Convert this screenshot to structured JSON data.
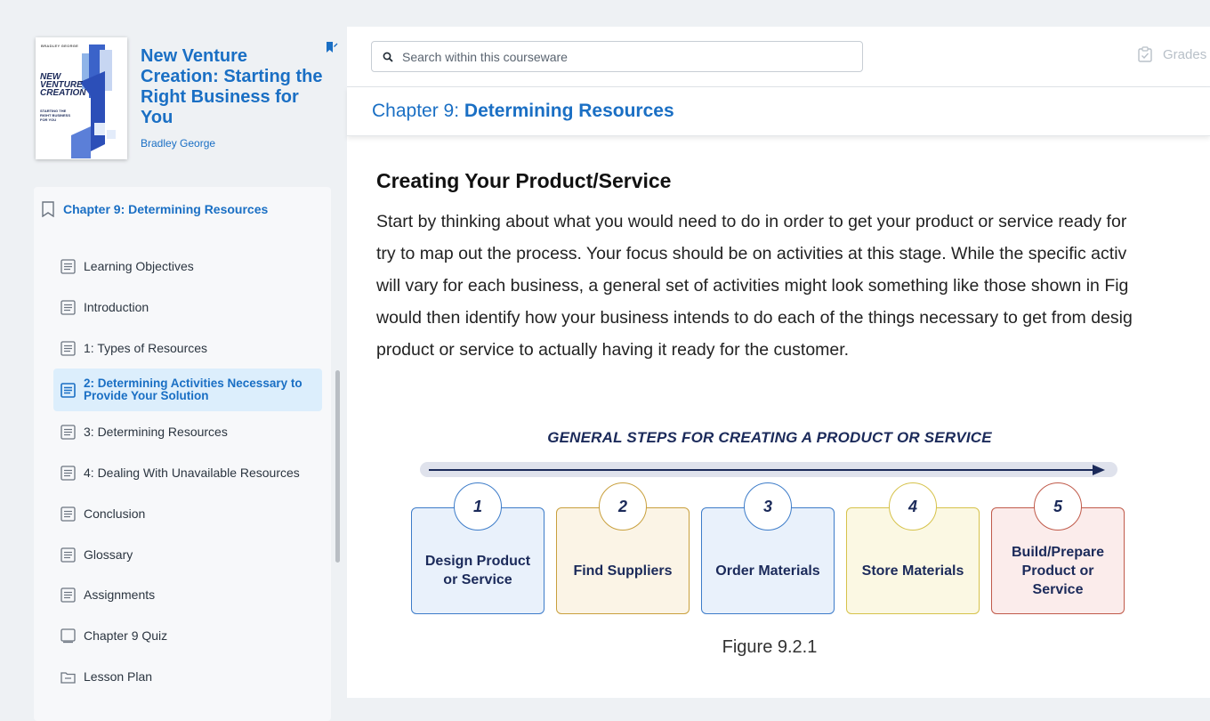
{
  "book": {
    "title": "New Venture Creation: Starting the Right Business for You",
    "author": "Bradley George",
    "cover": {
      "author": "BRADLEY GEORGE",
      "title": "NEW VENTURE CREATION",
      "subtitle": "STARTING THE RIGHT BUSINESS FOR YOU"
    }
  },
  "toc": {
    "chapter": "Chapter 9: Determining Resources",
    "items": [
      {
        "label": "Learning Objectives",
        "icon": "page-icon"
      },
      {
        "label": "Introduction",
        "icon": "page-icon"
      },
      {
        "label": "1: Types of Resources",
        "icon": "page-icon"
      },
      {
        "label": "2: Determining Activities Necessary to Provide Your Solution",
        "icon": "page-icon",
        "active": true
      },
      {
        "label": "3: Determining Resources",
        "icon": "page-icon"
      },
      {
        "label": "4: Dealing With Unavailable Resources",
        "icon": "page-icon"
      },
      {
        "label": "Conclusion",
        "icon": "page-icon"
      },
      {
        "label": "Glossary",
        "icon": "page-icon"
      },
      {
        "label": "Assignments",
        "icon": "page-icon"
      },
      {
        "label": "Chapter 9 Quiz",
        "icon": "quiz-icon"
      },
      {
        "label": "Lesson Plan",
        "icon": "folder-icon"
      }
    ]
  },
  "topbar": {
    "search_placeholder": "Search within this courseware",
    "grades_label": "Grades"
  },
  "chapter_bar": {
    "prefix": "Chapter 9: ",
    "title": "Determining Resources"
  },
  "content": {
    "heading": "Creating Your Product/Service",
    "lines": [
      "Start by thinking about what you would need to do in order to get your product or service ready for",
      "try to map out the process. Your focus should be on activities at this stage. While the specific activ",
      "will vary for each business, a general set of activities might look something like those shown in Fig",
      "would then identify how your business intends to do each of the things necessary to get from desig",
      "product or service to actually having it ready for the customer."
    ]
  },
  "figure": {
    "title": "GENERAL STEPS FOR CREATING A PRODUCT OR SERVICE",
    "caption": "Figure 9.2.1",
    "steps": [
      {
        "num": "1",
        "label": "Design Product or Service",
        "border": "#3d7cc9",
        "fill": "#e9f1fb"
      },
      {
        "num": "2",
        "label": "Find Suppliers",
        "border": "#c9a03d",
        "fill": "#fbf4e6"
      },
      {
        "num": "3",
        "label": "Order Materials",
        "border": "#3d7cc9",
        "fill": "#e9f1fb"
      },
      {
        "num": "4",
        "label": "Store Materials",
        "border": "#d6c24a",
        "fill": "#fbf8e3"
      },
      {
        "num": "5",
        "label": "Build/Prepare Product or Service",
        "border": "#c05a4a",
        "fill": "#fbeceb"
      }
    ]
  },
  "colors": {
    "accent": "#1a6fc4",
    "active_bg": "#dceefc",
    "navy": "#1b2a5a"
  }
}
